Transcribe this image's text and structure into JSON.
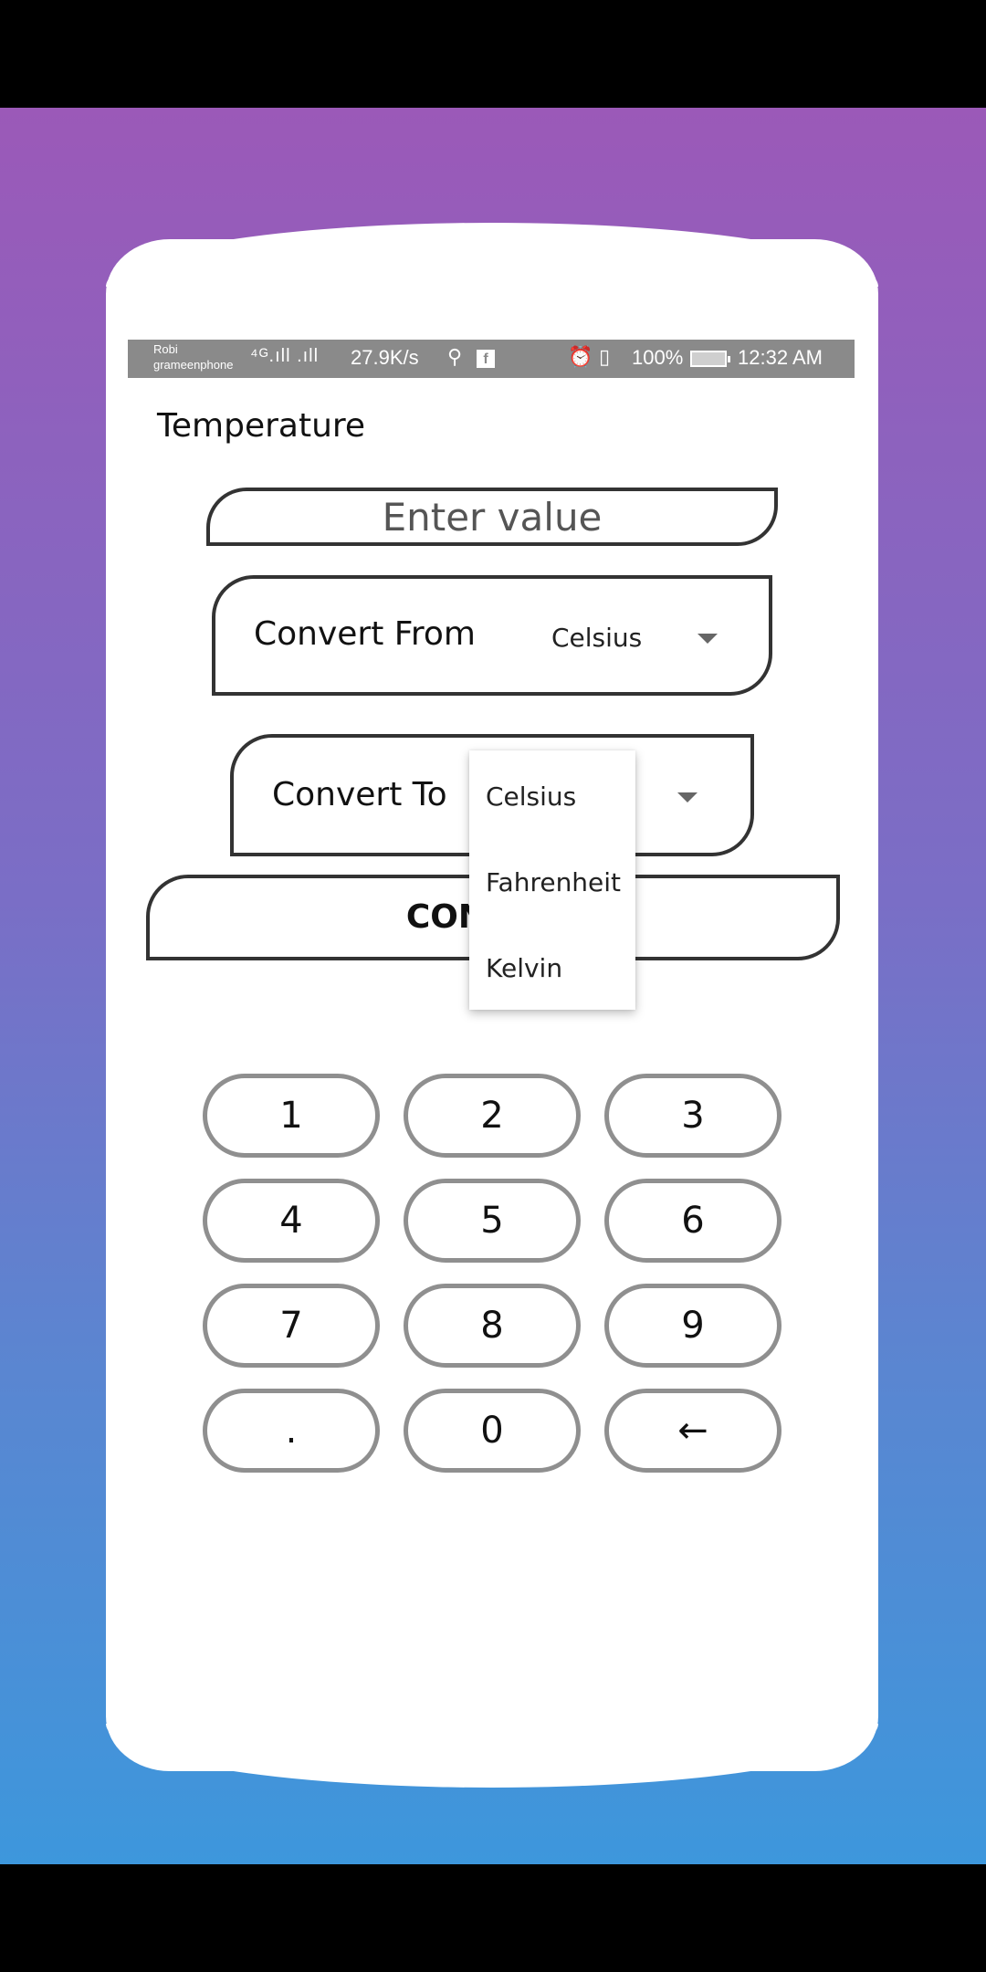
{
  "status_bar": {
    "carrier_1": "Robi",
    "carrier_2": "grameenphone",
    "network_signals": "⁴ᴳ.ıll .ıll",
    "net_speed": "27.9K/s",
    "battery_percent": "100%",
    "time": "12:32 AM"
  },
  "screen": {
    "title": "Temperature",
    "value_input": {
      "placeholder": "Enter value",
      "value": ""
    },
    "convert_from": {
      "label": "Convert From",
      "selected": "Celsius"
    },
    "convert_to": {
      "label": "Convert To",
      "selected": "Celsius"
    },
    "convert_button": "CONVERT"
  },
  "dropdown": {
    "options": [
      "Celsius",
      "Fahrenheit",
      "Kelvin"
    ]
  },
  "keypad": {
    "keys": [
      "1",
      "2",
      "3",
      "4",
      "5",
      "6",
      "7",
      "8",
      "9",
      ".",
      "0",
      "←"
    ]
  },
  "colors": {
    "gradient_top": "#9b59b8",
    "gradient_bottom": "#3d97dc",
    "border": "#333333",
    "key_border": "#8f8f8f"
  }
}
